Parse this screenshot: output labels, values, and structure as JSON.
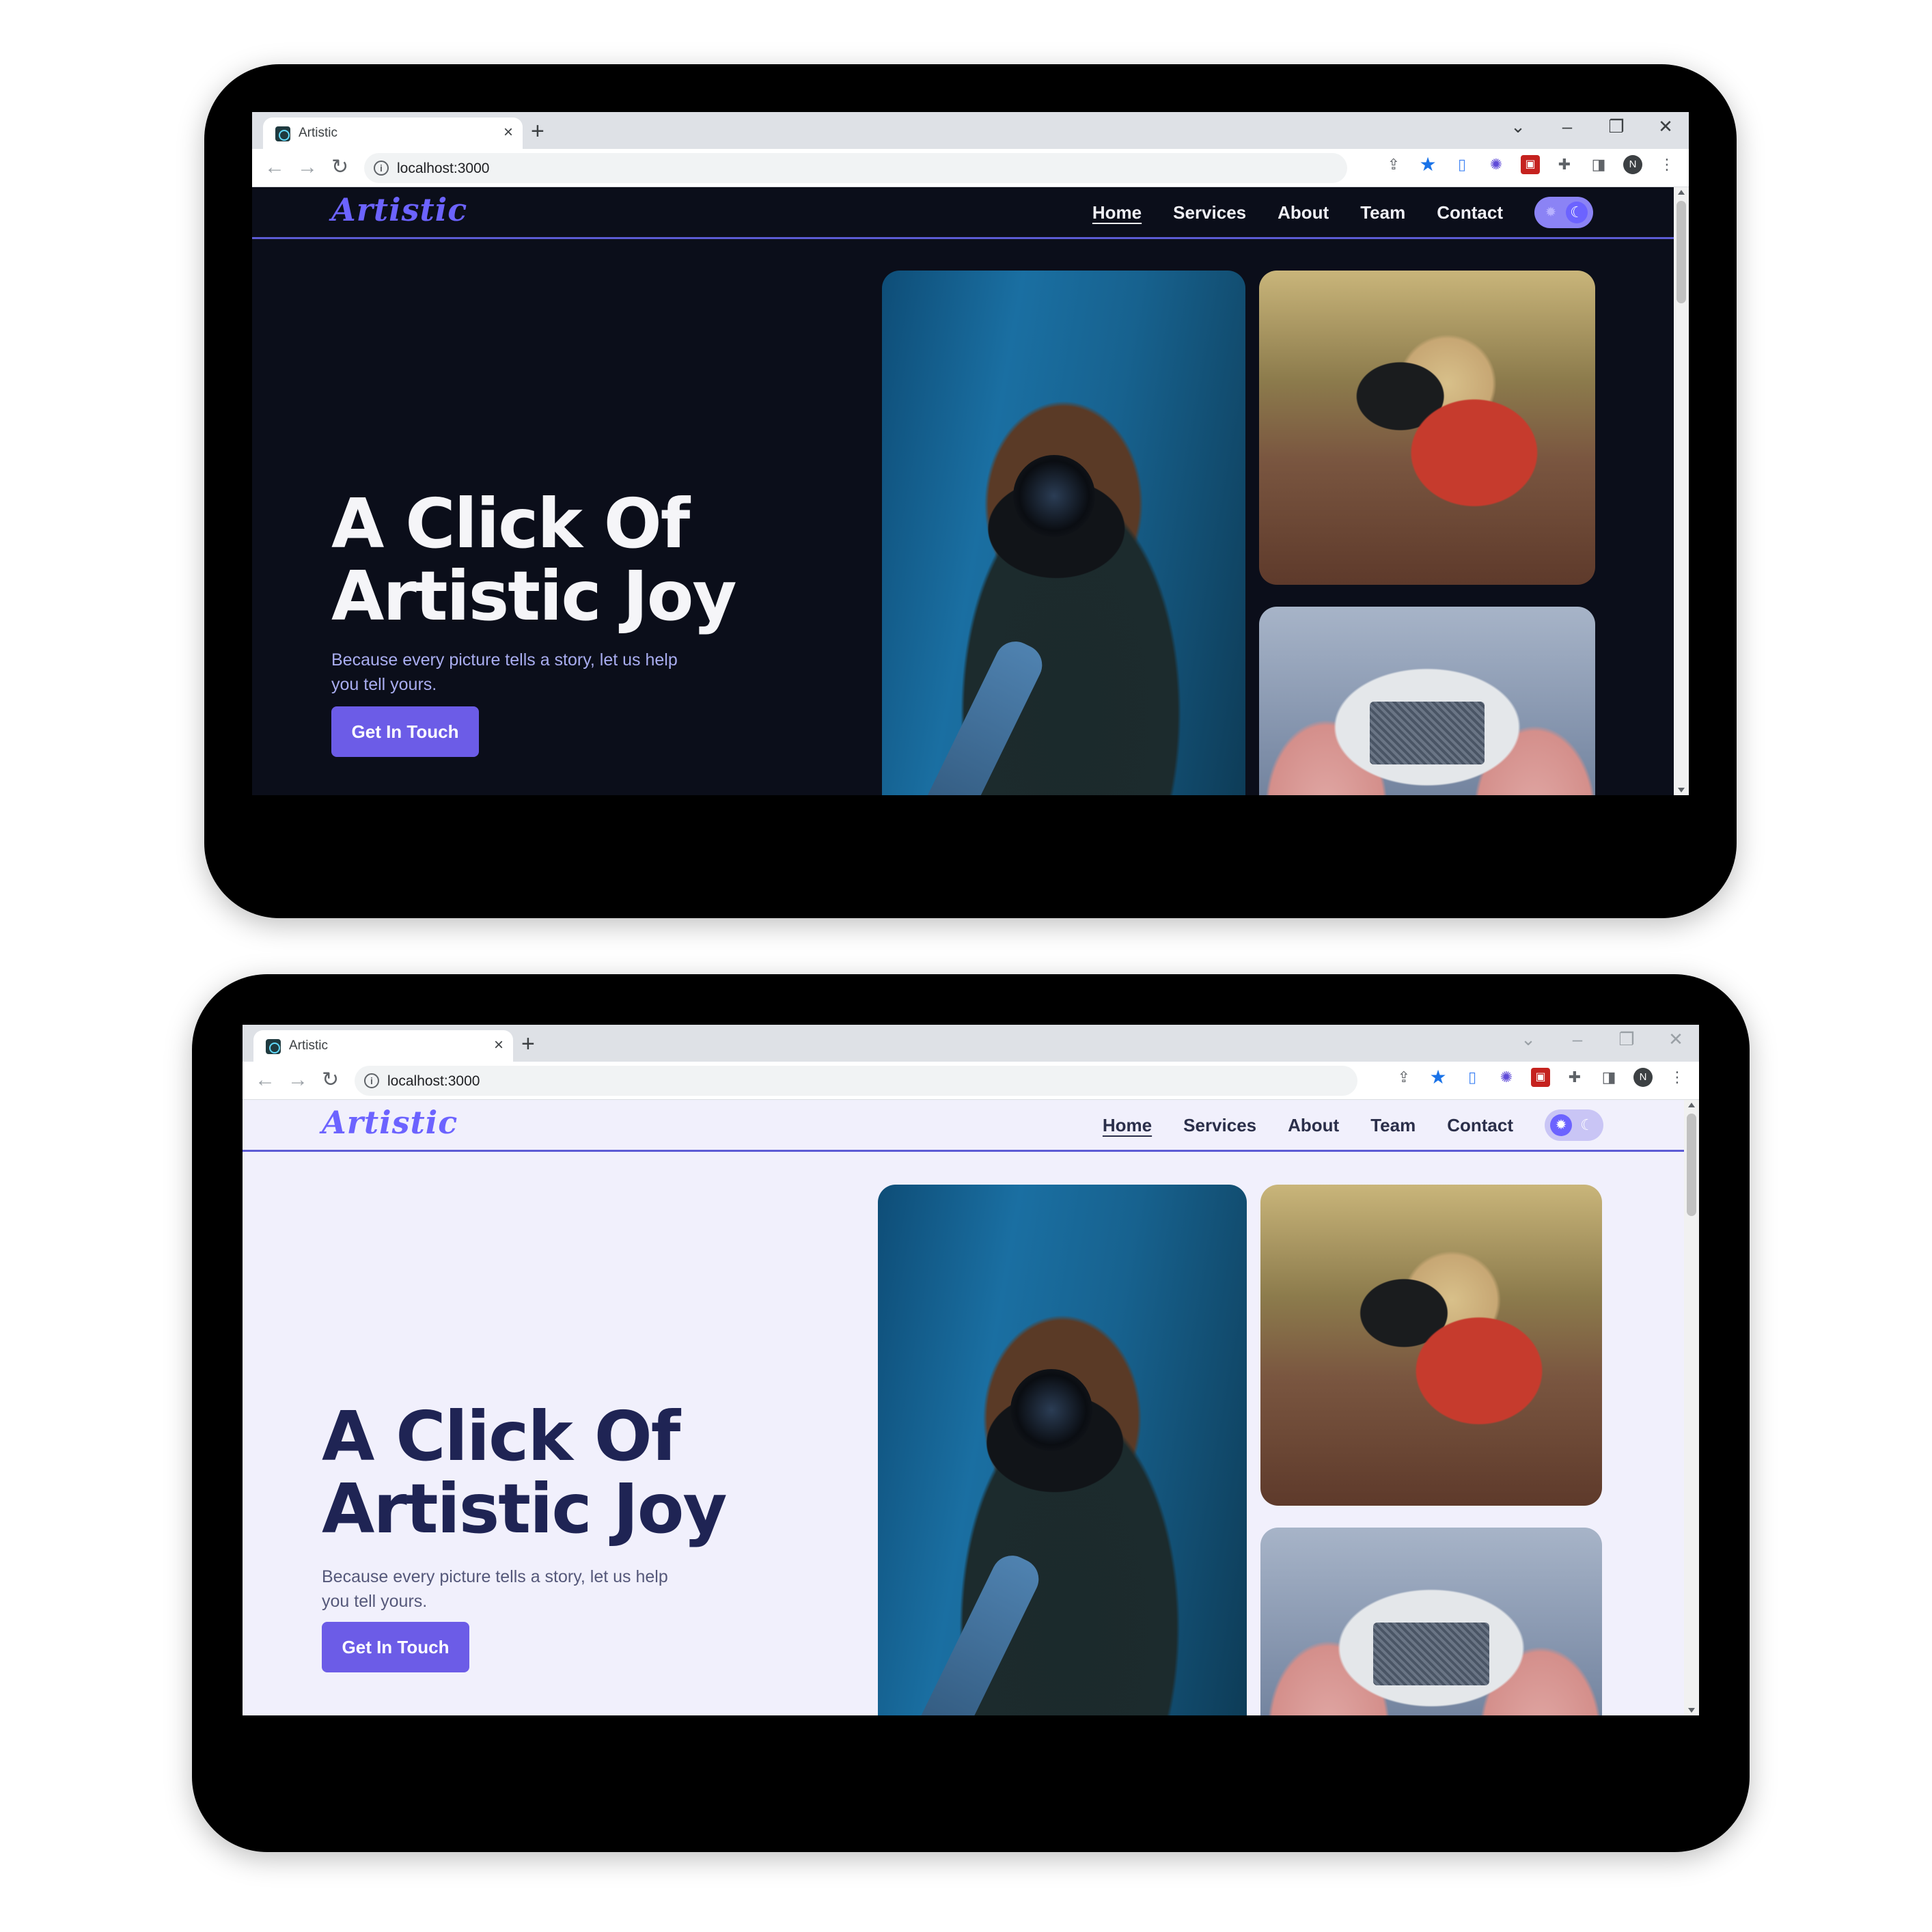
{
  "screens": [
    {
      "theme": "dark",
      "browser": {
        "tab_title": "Artistic",
        "tab_close": "×",
        "new_tab": "+",
        "url": "localhost:3000",
        "avatar_letter": "N",
        "window_controls": [
          "⌄",
          "–",
          "❐",
          "✕"
        ]
      },
      "site": {
        "logo": "Artistic",
        "menu": [
          "Home",
          "Services",
          "About",
          "Team",
          "Contact"
        ],
        "active_menu": "Home",
        "theme_toggle": "dark",
        "hero_title_line1": "A Click Of",
        "hero_title_line2": "Artistic Joy",
        "hero_subtitle": "Because every picture tells a story, let us help you tell yours.",
        "cta_label": "Get In Touch"
      }
    },
    {
      "theme": "light",
      "browser": {
        "tab_title": "Artistic",
        "tab_close": "×",
        "new_tab": "+",
        "url": "localhost:3000",
        "avatar_letter": "N",
        "window_controls": [
          "⌄",
          "–",
          "❐",
          "✕"
        ]
      },
      "site": {
        "logo": "Artistic",
        "menu": [
          "Home",
          "Services",
          "About",
          "Team",
          "Contact"
        ],
        "active_menu": "Home",
        "theme_toggle": "light",
        "hero_title_line1": "A Click Of",
        "hero_title_line2": "Artistic Joy",
        "hero_subtitle": "Because every picture tells a story, let us help you tell yours.",
        "cta_label": "Get In Touch"
      }
    }
  ],
  "colors": {
    "accent": "#6c63ff",
    "dark_bg": "#0b0e1a",
    "light_bg": "#f1f0fc",
    "cta": "#6c5ce7"
  },
  "icons": {
    "favicon": "react-logo-icon",
    "toolbar": [
      "share-icon",
      "bookmark-star-icon",
      "extension-doc-icon",
      "extension-gear-icon",
      "extension-red-icon",
      "puzzle-icon",
      "sidepanel-icon",
      "profile-avatar",
      "kebab-menu-icon"
    ]
  }
}
